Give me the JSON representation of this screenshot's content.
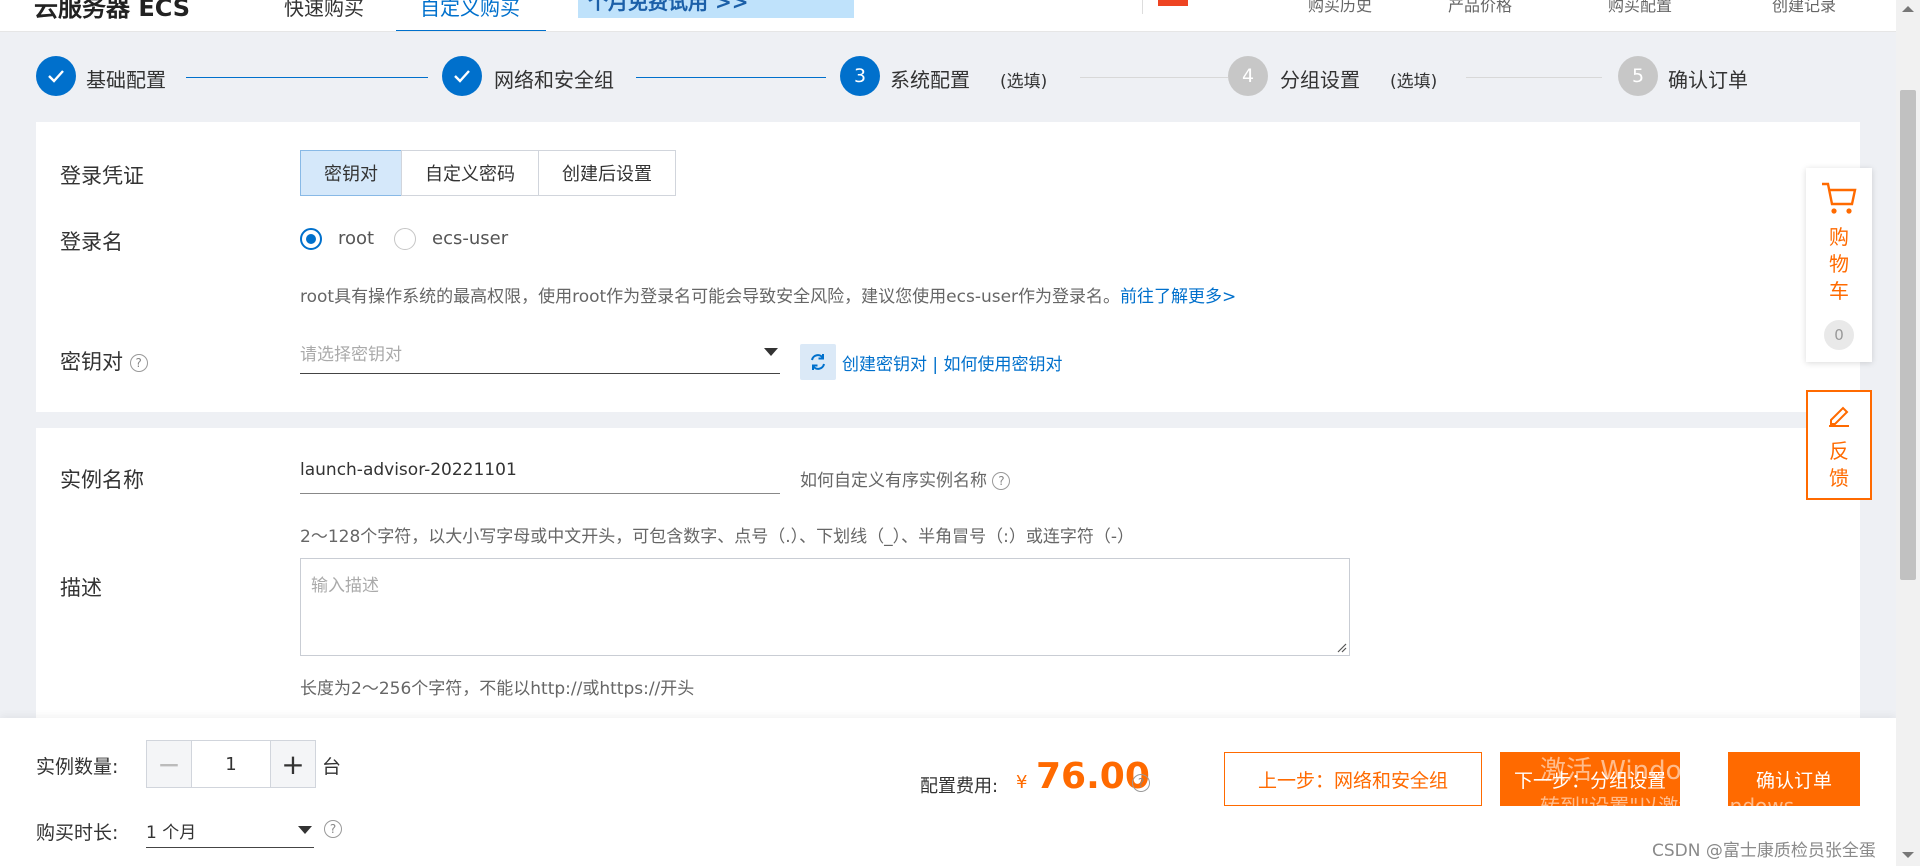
{
  "header": {
    "brand": "云服务器 ECS",
    "tabs": [
      "快速购买",
      "自定义购买"
    ],
    "promo": "个月免费试用 >>",
    "links": [
      "",
      "购买历史",
      "产品价格",
      "购买配置",
      "",
      "创建记录"
    ]
  },
  "steps": [
    {
      "num": "1",
      "label": "基础配置",
      "optional": "",
      "state": "done"
    },
    {
      "num": "2",
      "label": "网络和安全组",
      "optional": "",
      "state": "done"
    },
    {
      "num": "3",
      "label": "系统配置",
      "optional": "(选填)",
      "state": "active"
    },
    {
      "num": "4",
      "label": "分组设置",
      "optional": "(选填)",
      "state": "todo"
    },
    {
      "num": "5",
      "label": "确认订单",
      "optional": "",
      "state": "todo"
    }
  ],
  "login": {
    "credential_label": "登录凭证",
    "credential_options": [
      "密钥对",
      "自定义密码",
      "创建后设置"
    ],
    "credential_selected": "密钥对",
    "login_name_label": "登录名",
    "login_name_options": [
      "root",
      "ecs-user"
    ],
    "login_name_selected": "root",
    "root_hint": "root具有操作系统的最高权限，使用root作为登录名可能会导致安全风险，建议您使用ecs-user作为登录名。",
    "root_hint_link": "前往了解更多>",
    "keypair_label": "密钥对",
    "keypair_placeholder": "请选择密钥对",
    "create_keypair": "创建密钥对",
    "divider": " | ",
    "how_to_keypair": "如何使用密钥对"
  },
  "instance": {
    "name_label": "实例名称",
    "name_value": "launch-advisor-20221101",
    "name_help": "如何自定义有序实例名称",
    "name_rule": "2～128个字符，以大小写字母或中文开头，可包含数字、点号（.）、下划线（_）、半角冒号（:）或连字符（-）",
    "desc_label": "描述",
    "desc_placeholder": "输入描述",
    "desc_rule": "长度为2～256个字符，不能以http://或https://开头"
  },
  "footer": {
    "qty_label": "实例数量:",
    "qty_value": "1",
    "qty_unit": "台",
    "duration_label": "购买时长:",
    "duration_value": "1 个月",
    "fee_label": "配置费用:",
    "currency": "¥",
    "fee_value": "76.00",
    "prev_button": "上一步：网络和安全组",
    "next_button": "下一步：分组设置",
    "confirm_button": "确认订单"
  },
  "float": {
    "cart_label": "购物车",
    "cart_count": "0",
    "feedback_label": "反馈"
  },
  "overlay": {
    "activate_title": "激活 Windows",
    "activate_sub": "转到\"设置\"以激活 Windows。",
    "csdn": "CSDN @富士康质检员张全蛋"
  },
  "colors": {
    "primary": "#0070cc",
    "accent": "#ff6a00"
  }
}
